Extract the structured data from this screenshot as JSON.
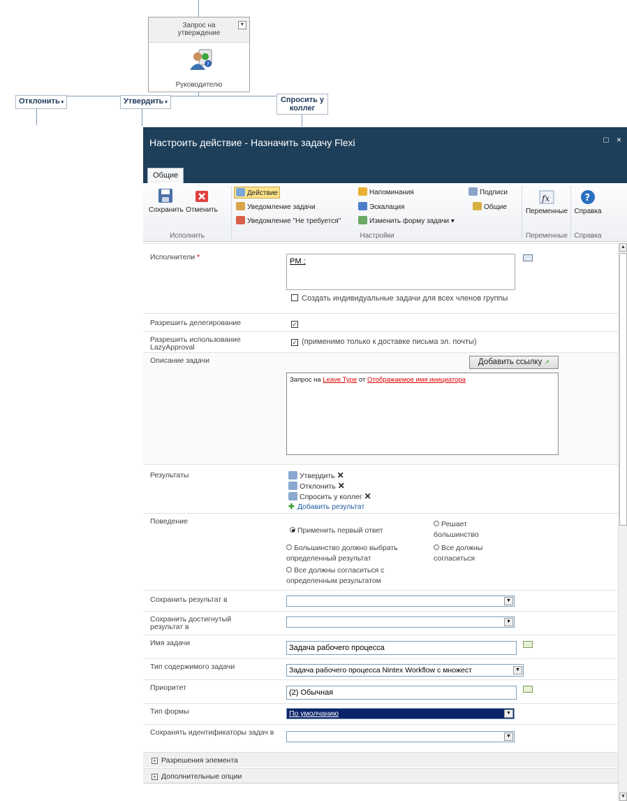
{
  "workflow": {
    "node_title": "Запрос на утверждение",
    "node_assignee": "Руководителю",
    "branches": [
      "Отклонить",
      "Утвердить",
      "Спросить у коллег"
    ]
  },
  "dialog": {
    "title": "Настроить действие - Назначить задачу Flexi",
    "controls": "□ ×"
  },
  "ribbon": {
    "tab": "Общие",
    "save": "Сохранить",
    "cancel": "Отменить",
    "group_execute": "Исполнить",
    "action": "Действие",
    "task_notification": "Уведомление задачи",
    "not_required_notification": "Уведомление \"Не требуется\"",
    "reminders": "Напоминания",
    "escalation": "Эскалация",
    "change_form": "Изменить форму задачи",
    "signatures": "Подписи",
    "general": "Общие",
    "group_settings": "Настройки",
    "variables": "Переменные",
    "group_variables": "Переменные",
    "help": "Справка",
    "group_help": "Справка"
  },
  "form": {
    "assignees_label": "Исполнители",
    "required_mark": "*",
    "assignees_value": "PM ;",
    "individual_tasks": "Создать индивидуальные задачи для всех членов группы",
    "allow_delegation_label": "Разрешить делегирование",
    "lazy_label": "Разрешить использование LazyApproval",
    "lazy_note": "(применимо только к доставке письма эл. почты)",
    "description_label": "Описание задачи",
    "add_link": "Добавить ссылку",
    "desc_prefix": "Запрос на ",
    "desc_link1": "Leave Type",
    "desc_mid": " от ",
    "desc_link2": "Отображаемое имя инициатора",
    "outcomes_label": "Результаты",
    "outcomes": [
      "Утвердить",
      "Отклонить",
      "Спросить у коллег"
    ],
    "add_outcome": "Добавить результат",
    "behavior_label": "Поведение",
    "behavior_first": "Применить первый ответ",
    "behavior_majority": "Решает большинство",
    "behavior_majority_specific": "Большинство должно выбрать определенный результат",
    "behavior_all": "Все должны согласиться",
    "behavior_all_specific": "Все должны согласиться с определенным результатом",
    "store_outcome_label": "Сохранить результат в",
    "store_achieved_label": "Сохранить достигнутый результат в",
    "task_name_label": "Имя задачи",
    "task_name_value": "Задача рабочего процесса",
    "content_type_label": "Тип содержимого задачи",
    "content_type_value": "Задача рабочего процесса Nintex Workflow с множест",
    "priority_label": "Приоритет",
    "priority_value": "(2) Обычная",
    "form_type_label": "Тип формы",
    "form_type_value": "По умолчанию",
    "store_ids_label": "Сохранять идентификаторы задач в",
    "item_permissions": "Разрешения элемента",
    "advanced_options": "Дополнительные опции"
  },
  "colors": {
    "title_bar": "#1e3f5a",
    "selected": "#0a246a",
    "link": "#dd0000"
  }
}
